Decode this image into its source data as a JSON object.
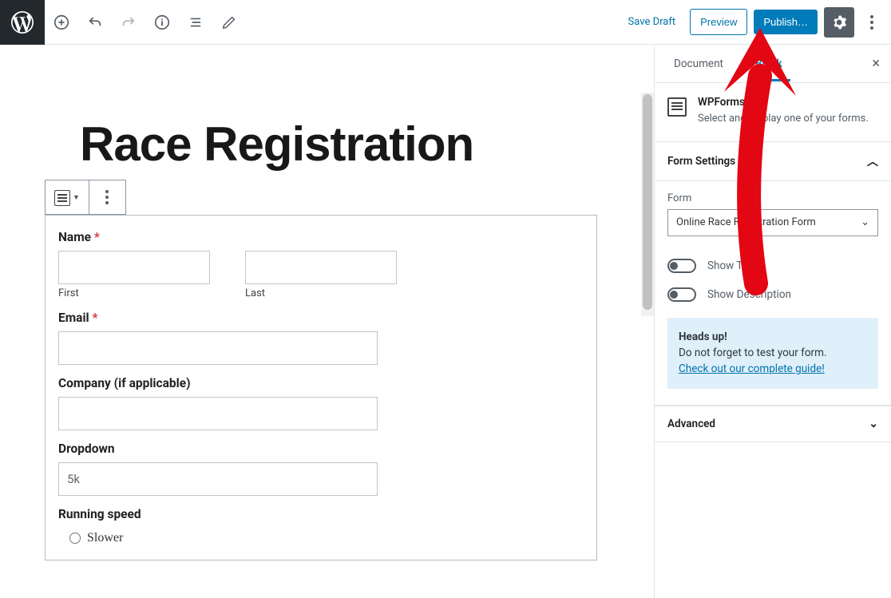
{
  "topbar": {
    "save_draft": "Save Draft",
    "preview": "Preview",
    "publish": "Publish…"
  },
  "editor": {
    "title": "Race Registration",
    "form": {
      "name": {
        "label": "Name",
        "required": true,
        "first": "First",
        "last": "Last"
      },
      "email": {
        "label": "Email",
        "required": true
      },
      "company": {
        "label": "Company (if applicable)"
      },
      "dropdown": {
        "label": "Dropdown",
        "value": "5k"
      },
      "running_speed": {
        "label": "Running speed",
        "option1": "Slower"
      }
    }
  },
  "sidebar": {
    "tabs": {
      "document": "Document",
      "block": "Block"
    },
    "block_name": "WPForms",
    "block_desc": "Select and display one of your forms.",
    "panels": {
      "form_settings": {
        "title": "Form Settings",
        "form_field_label": "Form",
        "form_selected": "Online Race Registration Form",
        "show_title": "Show Title",
        "show_description": "Show Description",
        "notice_heads": "Heads up!",
        "notice_text": "Do not forget to test your form.",
        "notice_link": "Check out our complete guide!"
      },
      "advanced": {
        "title": "Advanced"
      }
    }
  }
}
